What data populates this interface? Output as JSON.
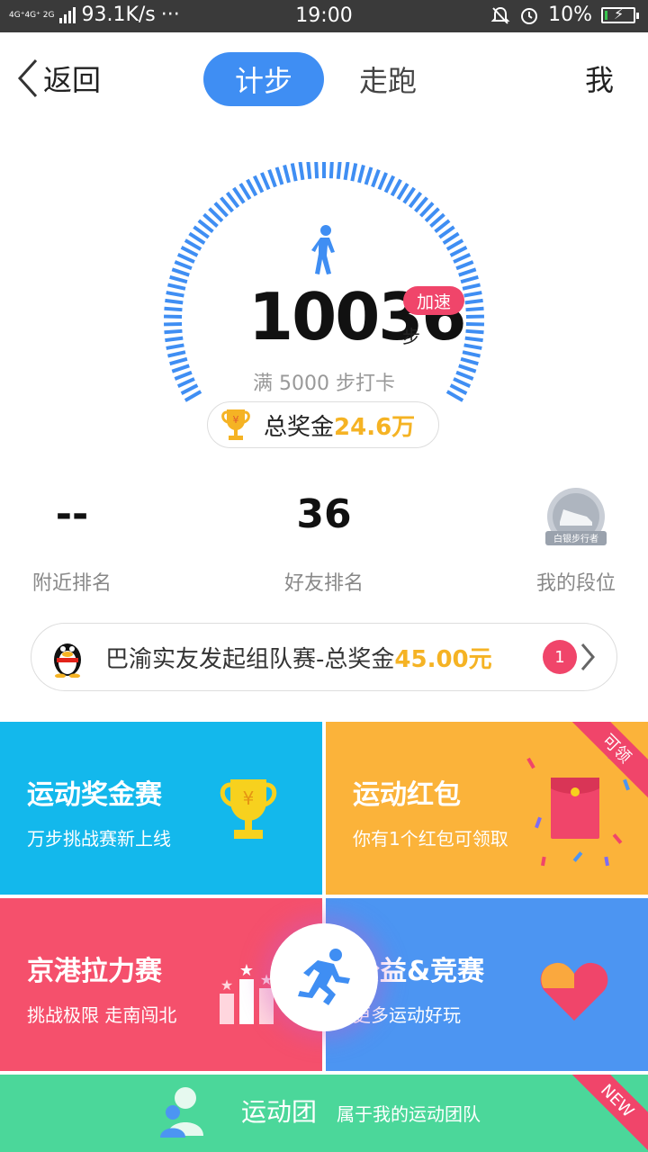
{
  "status_bar": {
    "network": "4G⁺4G⁺ 2G",
    "speed": "93.1K/s",
    "dots": "···",
    "time": "19:00",
    "battery": "10%",
    "battery_level": 0.1
  },
  "nav": {
    "back_label": "返回",
    "tabs": [
      {
        "label": "计步",
        "active": true
      },
      {
        "label": "走跑",
        "active": false
      }
    ],
    "me_label": "我"
  },
  "gauge": {
    "steps": "10036",
    "unit": "步",
    "speed_badge": "加速",
    "goal_text": "满 5000 步打卡",
    "prize_label": "总奖金",
    "prize_amount": "24.6万"
  },
  "rankings": [
    {
      "value": "--",
      "label": "附近排名"
    },
    {
      "value": "36",
      "label": "好友排名"
    },
    {
      "value": "",
      "label": "我的段位",
      "badge_text": "白银步行者"
    }
  ],
  "team_banner": {
    "text": "巴渝实友发起组队赛-总奖金",
    "amount": "45.00元",
    "count": "1"
  },
  "tiles": [
    {
      "title": "运动奖金赛",
      "subtitle": "万步挑战赛新上线"
    },
    {
      "title": "运动红包",
      "subtitle": "你有1个红包可领取",
      "ribbon": "可领"
    },
    {
      "title": "京港拉力赛",
      "subtitle": "挑战极限 走南闯北"
    },
    {
      "title": "公益&竞赛",
      "subtitle": "更多运动好玩"
    },
    {
      "title": "运动团",
      "subtitle": "属于我的运动团队",
      "ribbon": "NEW"
    }
  ],
  "colors": {
    "accent": "#3f8ef3",
    "red": "#f0456a",
    "gold": "#f5b324",
    "tile_blue": "#13b8ec",
    "tile_orange": "#fbb33a",
    "tile_red": "#f5506c",
    "tile_indigo": "#4c95f2",
    "tile_green": "#4bd79a"
  }
}
